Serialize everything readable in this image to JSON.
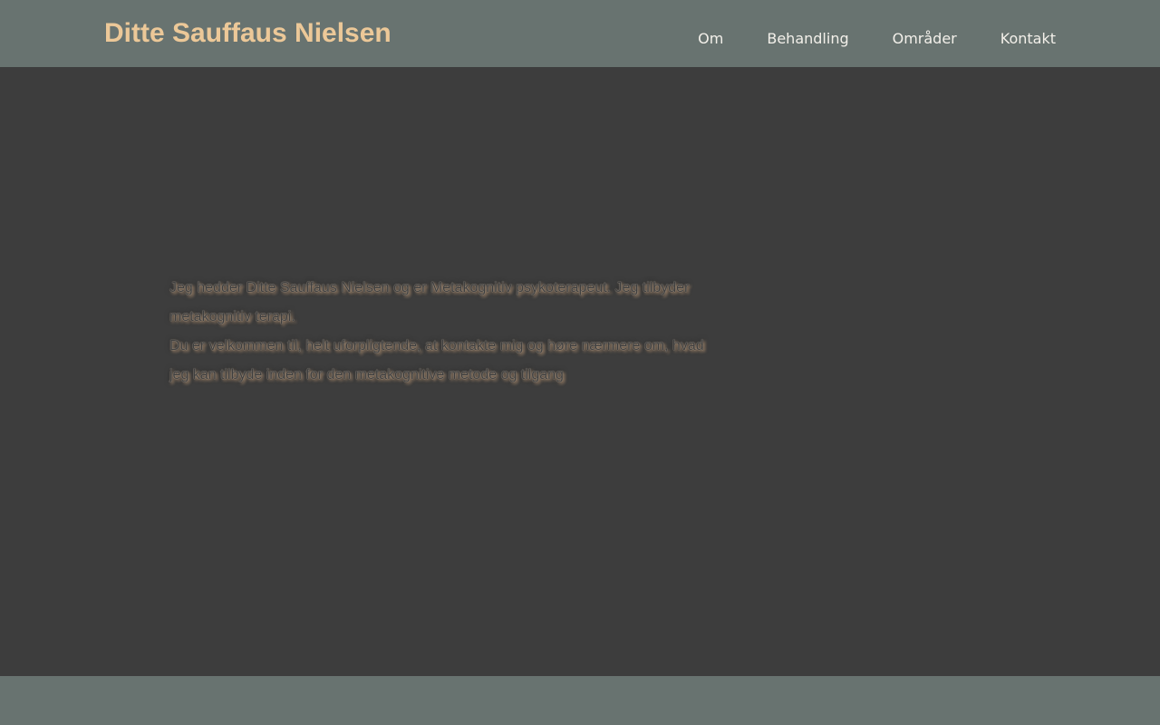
{
  "header": {
    "site_title": "Ditte Sauffaus Nielsen",
    "nav": [
      {
        "label": "Om"
      },
      {
        "label": "Behandling"
      },
      {
        "label": "Områder"
      },
      {
        "label": "Kontakt"
      }
    ]
  },
  "hero": {
    "paragraph_1": "Jeg hedder Ditte Sauffaus Nielsen og er Metakognitiv psykoterapeut. Jeg tilbyder metakognitiv terapi.",
    "paragraph_2": "Du er velkommen til, helt uforpligtende, at kontakte mig og høre nærmere om, hvad jeg kan tilbyde inden for den metakognitive metode og tilgang"
  },
  "colors": {
    "header_bg": "#687370",
    "hero_bg": "#3d3d3d",
    "title_accent": "#ecc898",
    "nav_text": "#f3f0ea"
  }
}
